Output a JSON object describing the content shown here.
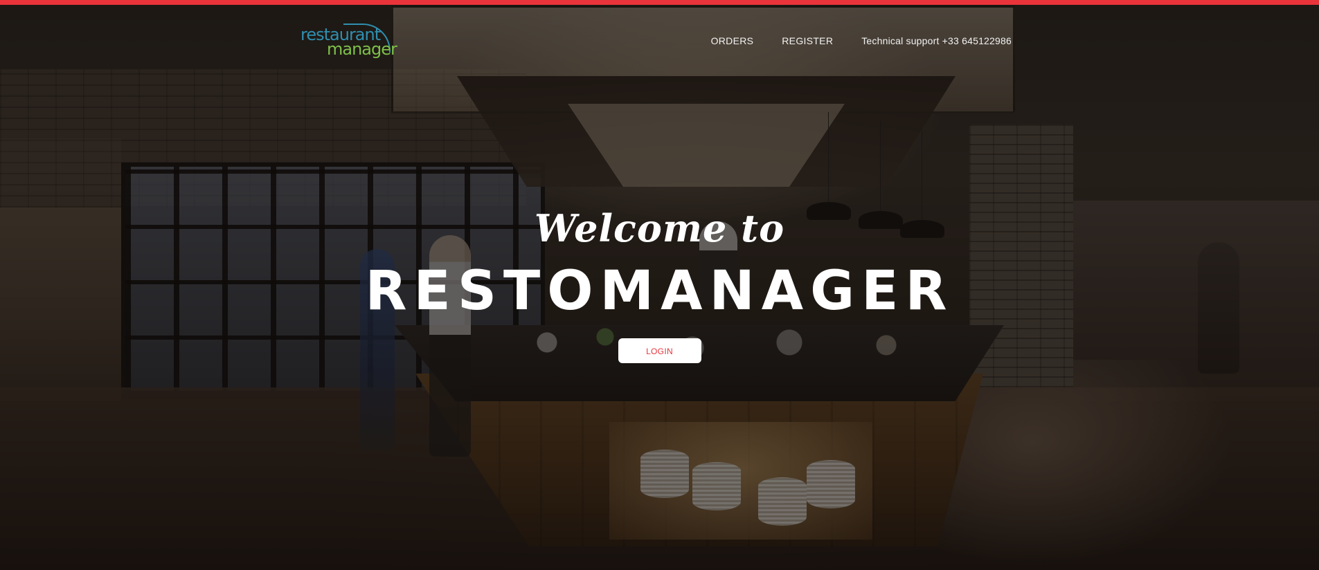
{
  "brand_colors": {
    "accent": "#e8343a",
    "logo_blue": "#2f8fb0",
    "logo_green": "#7fbf4a"
  },
  "logo": {
    "line1": "restaurant",
    "line2": "manager"
  },
  "nav": {
    "orders": "ORDERS",
    "register": "REGISTER",
    "support": "Technical support +33 645122986"
  },
  "hero": {
    "welcome": "Welcome to",
    "title": "RESTOMANAGER",
    "login": "LOGIN"
  },
  "background": {
    "icon": "restaurant-interior-photo"
  }
}
